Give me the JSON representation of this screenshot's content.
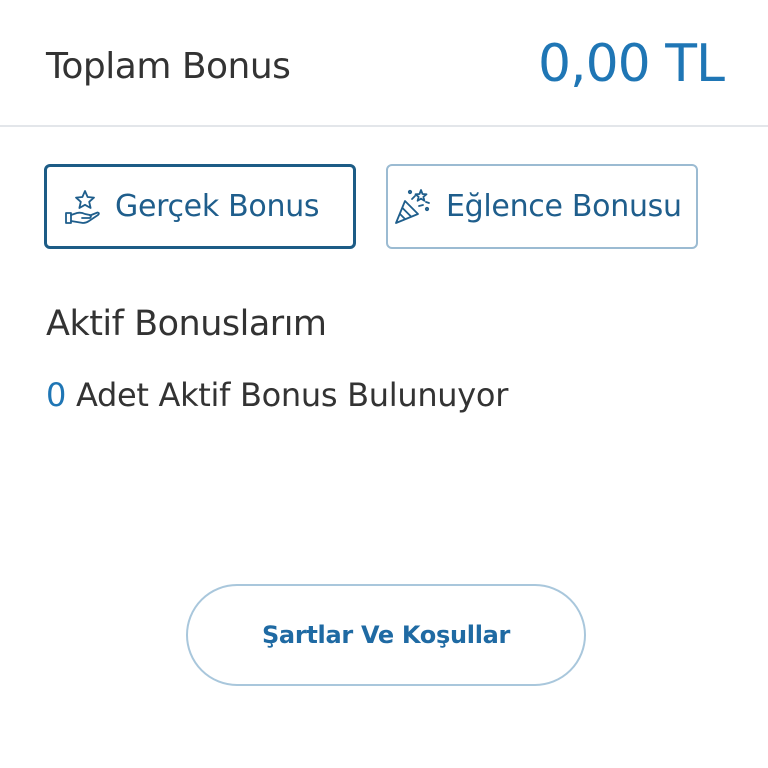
{
  "header": {
    "title": "Toplam Bonus",
    "amount": "0,00 TL"
  },
  "tabs": [
    {
      "label": "Gerçek Bonus",
      "icon": "hand-star-icon",
      "selected": true
    },
    {
      "label": "Eğlence Bonusu",
      "icon": "party-popper-icon",
      "selected": false
    }
  ],
  "active_bonuses": {
    "title": "Aktif Bonuslarım",
    "count": "0",
    "count_text": "Adet Aktif Bonus Bulunuyor"
  },
  "terms": {
    "label": "Şartlar Ve Koşullar"
  },
  "colors": {
    "accent": "#1f76b5",
    "selected_border": "#1d5c86",
    "text": "#333333"
  }
}
